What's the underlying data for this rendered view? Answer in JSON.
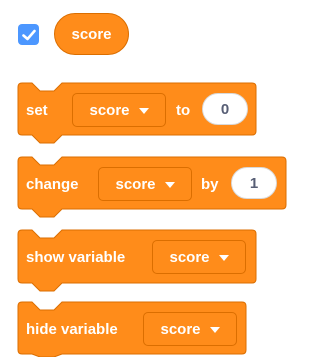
{
  "monitor": {
    "checked": true,
    "reporter_label": "score",
    "checkbox_color": "#4c97ff"
  },
  "colors": {
    "block_fill": "#ff8c1a",
    "block_stroke": "#db6e00",
    "input_text": "#575e75"
  },
  "blocks": {
    "set": {
      "label": "set",
      "variable": "score",
      "connector": "to",
      "value": "0"
    },
    "change": {
      "label": "change",
      "variable": "score",
      "connector": "by",
      "value": "1"
    },
    "show": {
      "label": "show variable",
      "variable": "score"
    },
    "hide": {
      "label": "hide variable",
      "variable": "score"
    }
  }
}
